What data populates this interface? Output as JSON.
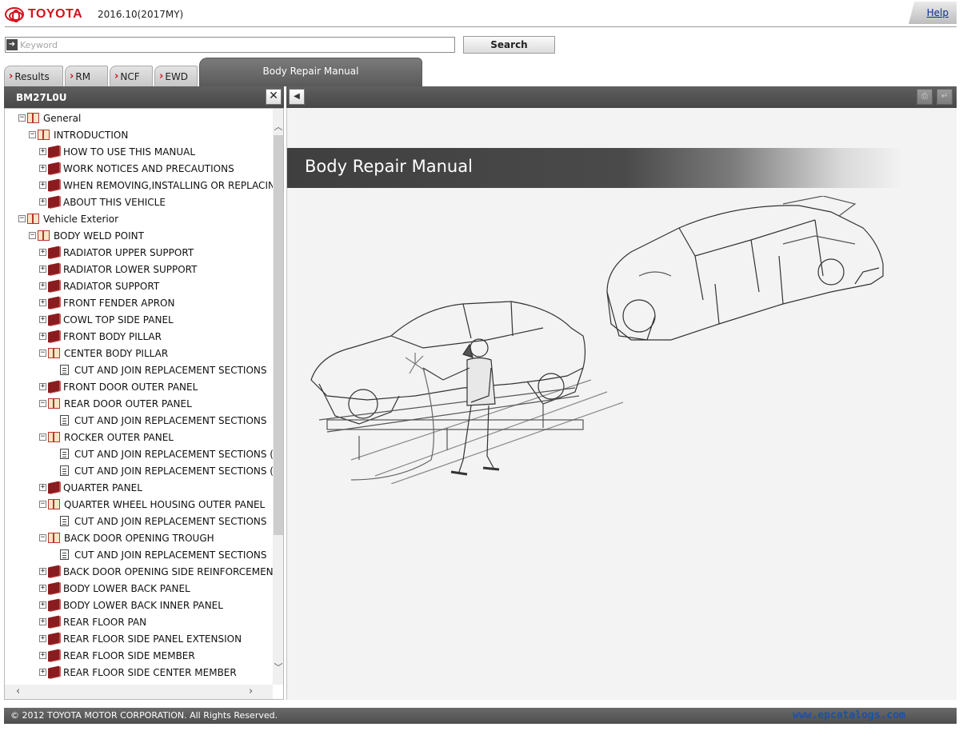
{
  "header": {
    "brand": "TOYOTA",
    "version": "2016.10(2017MY)",
    "help_label": "Help"
  },
  "search": {
    "placeholder": "Keyword",
    "button_label": "Search"
  },
  "tabs": [
    {
      "label": "Results"
    },
    {
      "label": "RM"
    },
    {
      "label": "NCF"
    },
    {
      "label": "EWD"
    },
    {
      "label": "Body Repair Manual",
      "active": true
    }
  ],
  "left_panel": {
    "title": "BM27L0U",
    "close_label": "✕"
  },
  "tree": [
    {
      "label": "General",
      "level": 0,
      "toggle": "−",
      "icon": "book-open-icon"
    },
    {
      "label": "INTRODUCTION",
      "level": 1,
      "toggle": "−",
      "icon": "book-open-icon"
    },
    {
      "label": "HOW TO USE THIS MANUAL",
      "level": 2,
      "toggle": "+",
      "icon": "book-closed-icon"
    },
    {
      "label": "WORK NOTICES AND PRECAUTIONS",
      "level": 2,
      "toggle": "+",
      "icon": "book-closed-icon"
    },
    {
      "label": "WHEN REMOVING,INSTALLING OR REPLACING",
      "level": 2,
      "toggle": "+",
      "icon": "book-closed-icon"
    },
    {
      "label": "ABOUT THIS VEHICLE",
      "level": 2,
      "toggle": "+",
      "icon": "book-closed-icon"
    },
    {
      "label": "Vehicle Exterior",
      "level": 0,
      "toggle": "−",
      "icon": "book-open-icon"
    },
    {
      "label": "BODY WELD POINT",
      "level": 1,
      "toggle": "−",
      "icon": "book-open-icon"
    },
    {
      "label": "RADIATOR UPPER SUPPORT",
      "level": 2,
      "toggle": "+",
      "icon": "book-closed-icon"
    },
    {
      "label": "RADIATOR LOWER SUPPORT",
      "level": 2,
      "toggle": "+",
      "icon": "book-closed-icon"
    },
    {
      "label": "RADIATOR SUPPORT",
      "level": 2,
      "toggle": "+",
      "icon": "book-closed-icon"
    },
    {
      "label": "FRONT FENDER APRON",
      "level": 2,
      "toggle": "+",
      "icon": "book-closed-icon"
    },
    {
      "label": "COWL TOP SIDE PANEL",
      "level": 2,
      "toggle": "+",
      "icon": "book-closed-icon"
    },
    {
      "label": "FRONT BODY PILLAR",
      "level": 2,
      "toggle": "+",
      "icon": "book-closed-icon"
    },
    {
      "label": "CENTER BODY PILLAR",
      "level": 2,
      "toggle": "−",
      "icon": "book-open-icon"
    },
    {
      "label": "CUT AND JOIN REPLACEMENT SECTIONS",
      "level": 3,
      "toggle": "",
      "icon": "page-icon"
    },
    {
      "label": "FRONT DOOR OUTER PANEL",
      "level": 2,
      "toggle": "+",
      "icon": "book-closed-icon"
    },
    {
      "label": "REAR DOOR OUTER PANEL",
      "level": 2,
      "toggle": "−",
      "icon": "book-open-icon"
    },
    {
      "label": "CUT AND JOIN REPLACEMENT SECTIONS",
      "level": 3,
      "toggle": "",
      "icon": "page-icon"
    },
    {
      "label": "ROCKER OUTER PANEL",
      "level": 2,
      "toggle": "−",
      "icon": "book-open-icon"
    },
    {
      "label": "CUT AND JOIN REPLACEMENT SECTIONS (SMA",
      "level": 3,
      "toggle": "",
      "icon": "page-icon"
    },
    {
      "label": "CUT AND JOIN REPLACEMENT SECTIONS (LAR",
      "level": 3,
      "toggle": "",
      "icon": "page-icon"
    },
    {
      "label": "QUARTER PANEL",
      "level": 2,
      "toggle": "+",
      "icon": "book-closed-icon"
    },
    {
      "label": "QUARTER WHEEL HOUSING OUTER PANEL",
      "level": 2,
      "toggle": "−",
      "icon": "book-open-icon"
    },
    {
      "label": "CUT AND JOIN REPLACEMENT SECTIONS",
      "level": 3,
      "toggle": "",
      "icon": "page-icon"
    },
    {
      "label": "BACK DOOR OPENING TROUGH",
      "level": 2,
      "toggle": "−",
      "icon": "book-open-icon"
    },
    {
      "label": "CUT AND JOIN REPLACEMENT SECTIONS",
      "level": 3,
      "toggle": "",
      "icon": "page-icon"
    },
    {
      "label": "BACK DOOR OPENING SIDE REINFORCEMENT",
      "level": 2,
      "toggle": "+",
      "icon": "book-closed-icon"
    },
    {
      "label": "BODY LOWER BACK PANEL",
      "level": 2,
      "toggle": "+",
      "icon": "book-closed-icon"
    },
    {
      "label": "BODY LOWER BACK INNER PANEL",
      "level": 2,
      "toggle": "+",
      "icon": "book-closed-icon"
    },
    {
      "label": "REAR FLOOR PAN",
      "level": 2,
      "toggle": "+",
      "icon": "book-closed-icon"
    },
    {
      "label": "REAR FLOOR SIDE PANEL EXTENSION",
      "level": 2,
      "toggle": "+",
      "icon": "book-closed-icon"
    },
    {
      "label": "REAR FLOOR SIDE MEMBER",
      "level": 2,
      "toggle": "+",
      "icon": "book-closed-icon"
    },
    {
      "label": "REAR FLOOR SIDE CENTER MEMBER",
      "level": 2,
      "toggle": "+",
      "icon": "book-closed-icon"
    }
  ],
  "content": {
    "banner_title": "Body Repair Manual"
  },
  "footer": {
    "copyright": "© 2012 TOYOTA MOTOR CORPORATION. All Rights Reserved.",
    "watermark": "www.epcatalogs.com"
  },
  "colors": {
    "brand_red": "#d3121c",
    "toolbar_gray": "#4f4f4f",
    "link_blue": "#0b2f8a"
  }
}
